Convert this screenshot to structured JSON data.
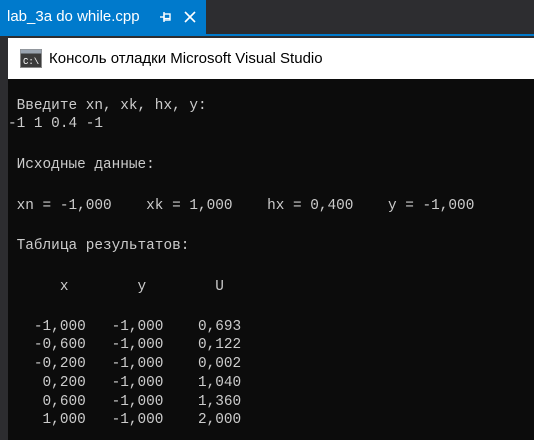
{
  "tab": {
    "title": "lab_3a do while.cpp",
    "pin_icon": "pin-icon",
    "close_icon": "close-icon"
  },
  "window": {
    "title": "Консоль отладки Microsoft Visual Studio",
    "icon": "console-app-icon"
  },
  "console": {
    "prompt": " Введите xn, xk, hx, y:",
    "input": "-1 1 0.4 -1",
    "source_header": " Исходные данные:",
    "params": " xn = -1,000    xk = 1,000    hx = 0,400    y = -1,000",
    "table_title": " Таблица результатов:",
    "table_header": "      x        y        U",
    "rows": [
      "   -1,000   -1,000    0,693",
      "   -0,600   -1,000    0,122",
      "   -0,200   -1,000    0,002",
      "    0,200   -1,000    1,040",
      "    0,600   -1,000    1,360",
      "    1,000   -1,000    2,000"
    ]
  },
  "colors": {
    "accent": "#007acc",
    "console_bg": "#0c0c0c",
    "console_text": "#cccccc"
  }
}
